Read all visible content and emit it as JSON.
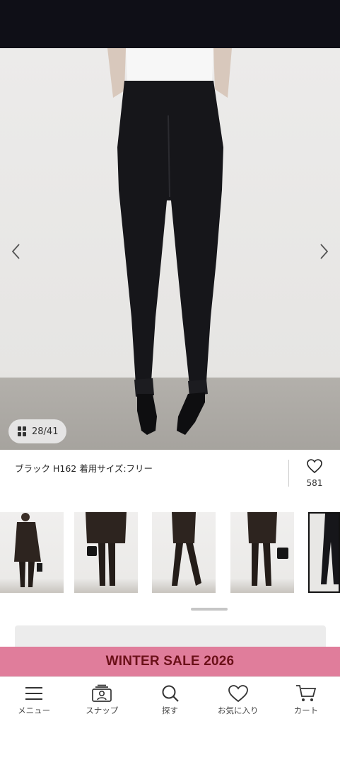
{
  "image": {
    "counter": "28/41",
    "caption": "ブラック H162 着用サイズ:フリー",
    "favorite_count": "581",
    "icons": {
      "prev": "chevron-left-icon",
      "next": "chevron-right-icon",
      "grid": "grid-icon",
      "favorite": "heart-icon"
    }
  },
  "promo": {
    "banner": "WINTER SALE 2026",
    "colors": {
      "background": "#e07d9b",
      "text": "#6b1119"
    }
  },
  "bottom_nav": [
    {
      "label": "メニュー",
      "icon": "menu-icon"
    },
    {
      "label": "スナップ",
      "icon": "snap-icon"
    },
    {
      "label": "探す",
      "icon": "search-icon"
    },
    {
      "label": "お気に入り",
      "icon": "heart-icon"
    },
    {
      "label": "カート",
      "icon": "cart-icon"
    }
  ]
}
